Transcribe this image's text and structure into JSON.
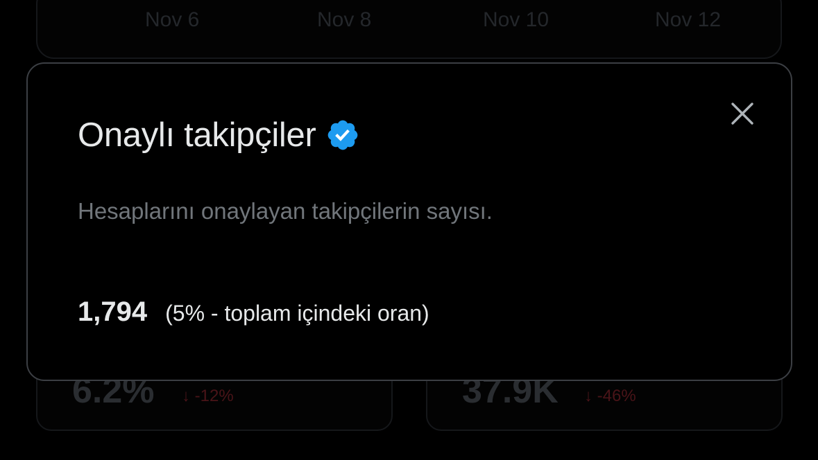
{
  "background": {
    "chart": {
      "x_ticks": [
        "Nov 6",
        "Nov 8",
        "Nov 10",
        "Nov 12"
      ]
    },
    "stat_cards": [
      {
        "value": "6.2%",
        "change": "↓ -12%"
      },
      {
        "value": "37.9K",
        "change": "↓ -46%"
      }
    ]
  },
  "modal": {
    "title": "Onaylı takipçiler",
    "description": "Hesaplarını onaylayan takipçilerin sayısı.",
    "count": "1,794",
    "count_note": "(5% - toplam içindeki oran)",
    "close_icon": "close-icon",
    "badge_icon": "verified-badge-icon"
  },
  "colors": {
    "background": "#000000",
    "title_text": "#e7e9ea",
    "secondary_text": "#71767b",
    "verified_blue": "#1d9bf0",
    "modal_border": "#3c3f44",
    "decrease_red": "#f4212e"
  }
}
